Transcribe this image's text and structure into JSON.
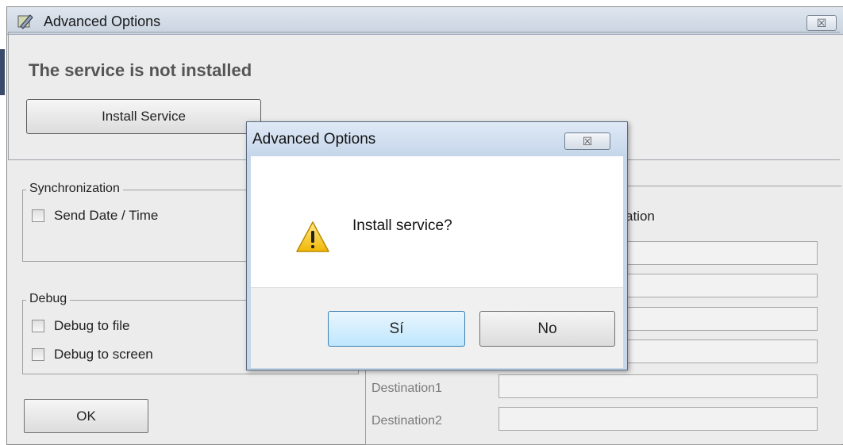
{
  "window": {
    "title": "Advanced Options",
    "close_glyph": "☒"
  },
  "status": {
    "message": "The service is not installed",
    "install_button": "Install Service"
  },
  "synchronization": {
    "legend": "Synchronization",
    "send_datetime": "Send Date / Time"
  },
  "debug": {
    "legend": "Debug",
    "to_file": "Debug to file",
    "to_screen": "Debug to screen"
  },
  "right": {
    "partial_label": "ation",
    "destination1": "Destination1",
    "destination2": "Destination2"
  },
  "ok_button": "OK",
  "dialog": {
    "title": "Advanced Options",
    "close_glyph": "☒",
    "message": "Install service?",
    "yes": "Sí",
    "no": "No"
  }
}
